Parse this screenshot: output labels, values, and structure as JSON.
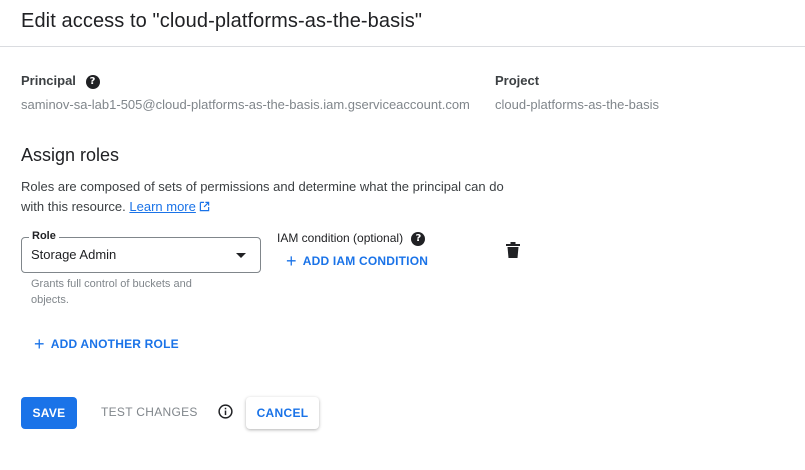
{
  "dialog": {
    "title": "Edit access to \"cloud-platforms-as-the-basis\""
  },
  "principal": {
    "label": "Principal",
    "help_icon": "help-circle-icon",
    "value": "saminov-sa-lab1-505@cloud-platforms-as-the-basis.iam.gserviceaccount.com"
  },
  "project": {
    "label": "Project",
    "value": "cloud-platforms-as-the-basis"
  },
  "roles": {
    "heading": "Assign roles",
    "description_line1": "Roles are composed of sets of permissions and determine what the principal can do",
    "description_line2": "with this resource.",
    "learn_more": "Learn more",
    "learn_more_icon": "open-in-new-icon",
    "role_field_label": "Role",
    "role_value": "Storage Admin",
    "role_hint": "Grants full control of buckets and objects.",
    "condition_label": "IAM condition (optional)",
    "add_condition": "ADD IAM CONDITION",
    "delete_icon": "trash-icon",
    "add_another_role": "ADD ANOTHER ROLE"
  },
  "actions": {
    "save": "SAVE",
    "test_changes": "TEST CHANGES",
    "info_icon": "info-icon",
    "cancel": "CANCEL"
  },
  "colors": {
    "accent": "#1a73e8",
    "text": "#202124",
    "muted": "#80868b"
  }
}
